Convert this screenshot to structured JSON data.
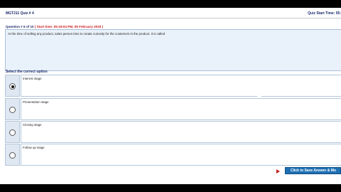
{
  "header": {
    "quiz_title": "MGT211 Quiz # 4",
    "quiz_start_label": "Quiz Start Time: 05:"
  },
  "question": {
    "number": "Question # 6 of 10 ",
    "timing": "( Start time: 05:18:53 PM, 09 February 2018 )",
    "text": "At the time of selling any product, sales person tries to create curiosity for the customers in the product. It is called"
  },
  "select_label": "Select the correct option",
  "options": [
    {
      "label": "Interest stage",
      "selected": true
    },
    {
      "label": "Presentation stage",
      "selected": false
    },
    {
      "label": "Closing stage",
      "selected": false
    },
    {
      "label": "Follow up stage",
      "selected": false
    }
  ],
  "footer": {
    "save_button": "Click to Save Answer & Mo"
  }
}
